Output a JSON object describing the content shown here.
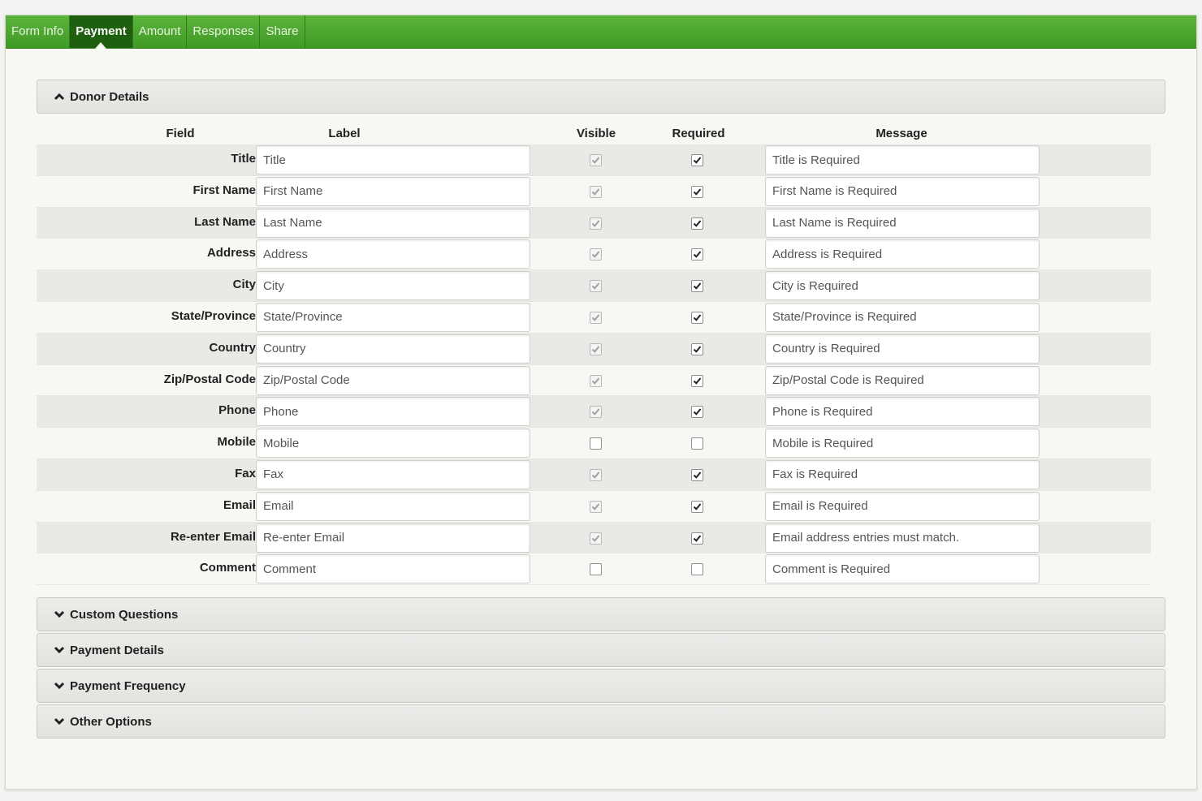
{
  "tabs": [
    {
      "label": "Form Info",
      "active": false
    },
    {
      "label": "Payment",
      "active": true
    },
    {
      "label": "Amount",
      "active": false
    },
    {
      "label": "Responses",
      "active": false
    },
    {
      "label": "Share",
      "active": false
    }
  ],
  "donor_details": {
    "title": "Donor Details",
    "expanded": true,
    "columns": {
      "field": "Field",
      "label": "Label",
      "visible": "Visible",
      "required": "Required",
      "message": "Message"
    },
    "rows": [
      {
        "field": "Title",
        "label": "Title",
        "visible": true,
        "visible_disabled": true,
        "required": true,
        "message": "Title is Required"
      },
      {
        "field": "First Name",
        "label": "First Name",
        "visible": true,
        "visible_disabled": true,
        "required": true,
        "message": "First Name is Required"
      },
      {
        "field": "Last Name",
        "label": "Last Name",
        "visible": true,
        "visible_disabled": true,
        "required": true,
        "message": "Last Name is Required"
      },
      {
        "field": "Address",
        "label": "Address",
        "visible": true,
        "visible_disabled": true,
        "required": true,
        "message": "Address is Required"
      },
      {
        "field": "City",
        "label": "City",
        "visible": true,
        "visible_disabled": true,
        "required": true,
        "message": "City is Required"
      },
      {
        "field": "State/Province",
        "label": "State/Province",
        "visible": true,
        "visible_disabled": true,
        "required": true,
        "message": "State/Province is Required"
      },
      {
        "field": "Country",
        "label": "Country",
        "visible": true,
        "visible_disabled": true,
        "required": true,
        "message": "Country is Required"
      },
      {
        "field": "Zip/Postal Code",
        "label": "Zip/Postal Code",
        "visible": true,
        "visible_disabled": true,
        "required": true,
        "message": "Zip/Postal Code is Required"
      },
      {
        "field": "Phone",
        "label": "Phone",
        "visible": true,
        "visible_disabled": true,
        "required": true,
        "message": "Phone is Required"
      },
      {
        "field": "Mobile",
        "label": "Mobile",
        "visible": false,
        "visible_disabled": false,
        "required": false,
        "message": "Mobile is Required"
      },
      {
        "field": "Fax",
        "label": "Fax",
        "visible": true,
        "visible_disabled": true,
        "required": true,
        "message": "Fax is Required"
      },
      {
        "field": "Email",
        "label": "Email",
        "visible": true,
        "visible_disabled": true,
        "required": true,
        "message": "Email is Required"
      },
      {
        "field": "Re-enter Email",
        "label": "Re-enter Email",
        "visible": true,
        "visible_disabled": true,
        "required": true,
        "message": "Email address entries must match."
      },
      {
        "field": "Comment",
        "label": "Comment",
        "visible": false,
        "visible_disabled": false,
        "required": false,
        "message": "Comment is Required"
      }
    ]
  },
  "collapsed_sections": [
    {
      "title": "Custom Questions"
    },
    {
      "title": "Payment Details"
    },
    {
      "title": "Payment Frequency"
    },
    {
      "title": "Other Options"
    }
  ],
  "colors": {
    "tab_green": "#4aa52d",
    "tab_active": "#1f5f10"
  }
}
